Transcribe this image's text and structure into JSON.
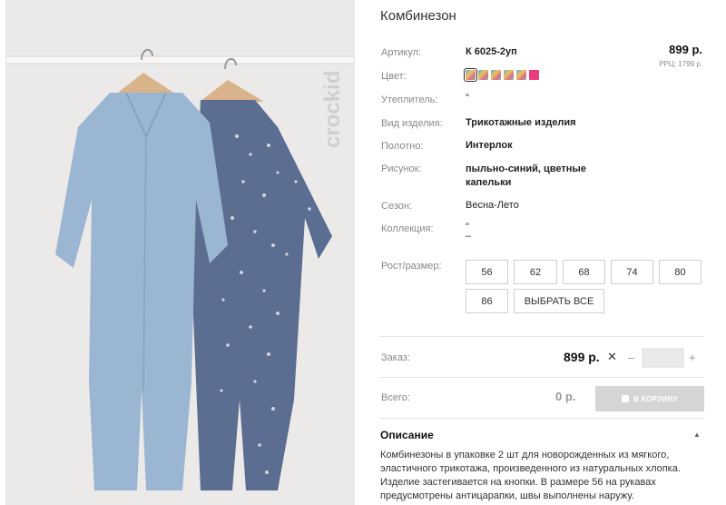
{
  "product": {
    "title": "Комбинезон",
    "price": "899 р.",
    "rrc": "РРЦ: 1799 р."
  },
  "brand": {
    "logo_text": "crockid"
  },
  "attributes": {
    "article_label": "Артикул:",
    "article_value": "К 6025-2уп",
    "color_label": "Цвет:",
    "insulation_label": "Утеплитель:",
    "insulation_value": "\"",
    "type_label": "Вид изделия:",
    "type_value": "Трикотажные изделия",
    "fabric_label": "Полотно:",
    "fabric_value": "Интерлок",
    "pattern_label": "Рисунок:",
    "pattern_value_line1": "пыльно-синий, цветные",
    "pattern_value_line2": "капельки",
    "season_label": "Сезон:",
    "season_value": "Весна-Лето",
    "collection_label": "Коллекция:",
    "collection_value_line1": "\"",
    "collection_value_line2": "–",
    "size_label": "Рост/размер:"
  },
  "colors": [
    {
      "name": "multicolor-1",
      "color": "#6aa3d8",
      "selected": true
    },
    {
      "name": "multicolor-2",
      "color": "#e8c65a"
    },
    {
      "name": "multicolor-3",
      "color": "#e06b8a"
    },
    {
      "name": "multicolor-4",
      "color": "#7cc2a5"
    },
    {
      "name": "multicolor-5",
      "color": "#e8c65a"
    },
    {
      "name": "pink",
      "color": "#ec3a7e"
    }
  ],
  "sizes": [
    "56",
    "62",
    "68",
    "74",
    "80",
    "86"
  ],
  "select_all_label": "ВЫБРАТЬ ВСЕ",
  "order": {
    "label": "Заказ:",
    "price": "899 р.",
    "times": "✕",
    "minus": "–",
    "plus": "+",
    "qty_value": ""
  },
  "total": {
    "label": "Всего:",
    "price": "0 р.",
    "cart_button": "В КОРЗИНУ"
  },
  "description": {
    "title": "Описание",
    "toggle": "▲",
    "text": "Комбинезоны в упаковке 2 шт для новорожденных из мягкого, эластичного трикотажа, произведенного из натуральных хлопка. Изделие застегивается на кнопки. В размере 56 на рукавах предусмотрены антицарапки, швы выполнены наружу."
  }
}
